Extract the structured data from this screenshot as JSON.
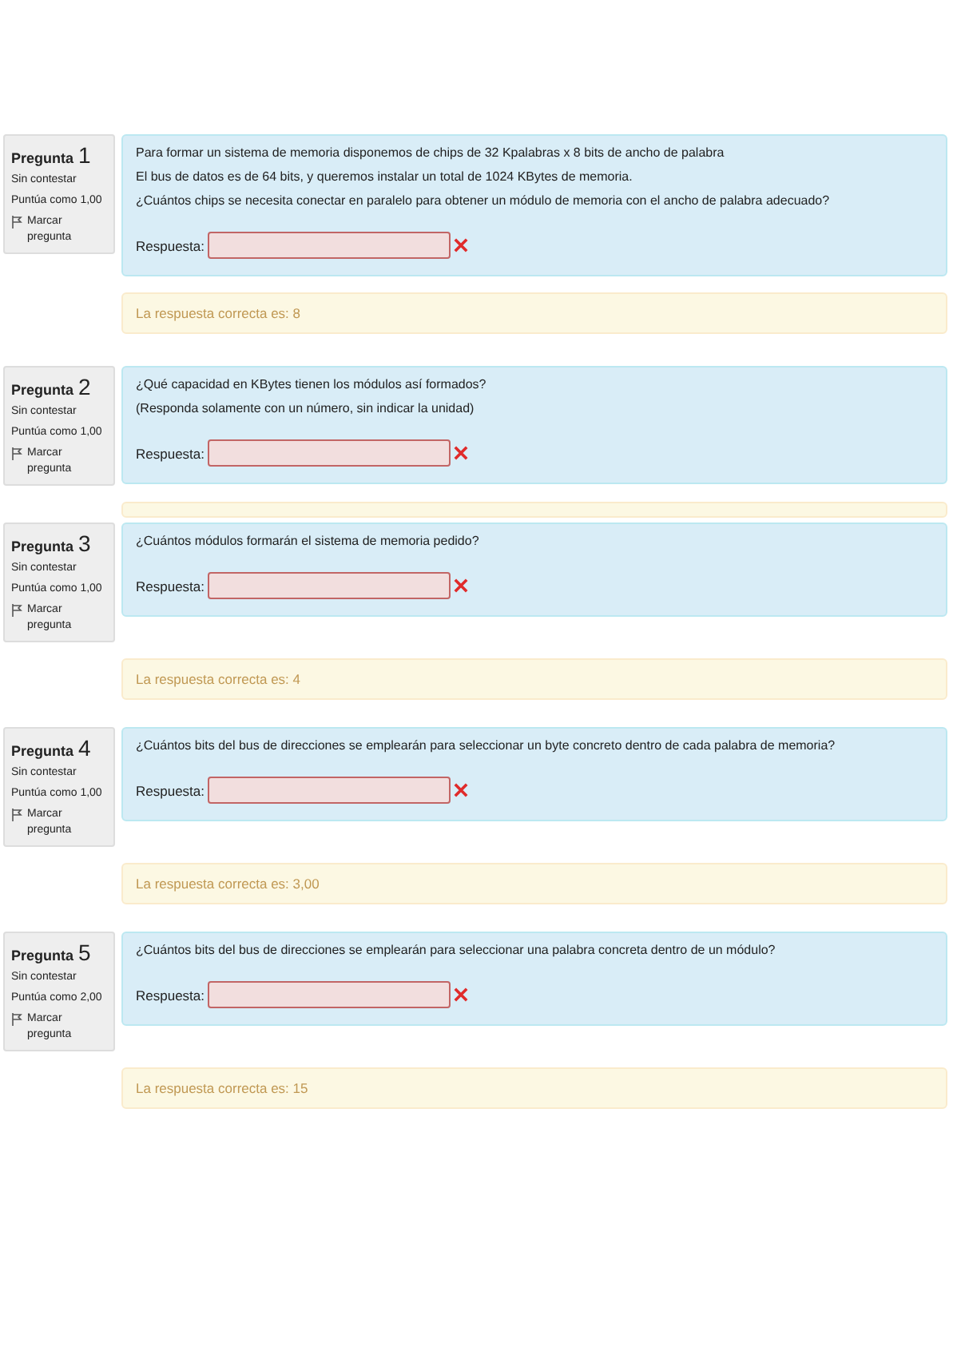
{
  "questions": [
    {
      "label": "Pregunta",
      "number": "1",
      "status": "Sin contestar",
      "points": "Puntúa como 1,00",
      "flag": "Marcar pregunta",
      "text": [
        "Para formar un sistema de memoria disponemos de chips de 32 Kpalabras x 8 bits de ancho de palabra",
        "El bus de datos es de 64 bits, y queremos instalar un total de 1024 KBytes de memoria.",
        "¿Cuántos chips se necesita conectar en paralelo para obtener un módulo de memoria con el ancho de palabra adecuado?"
      ],
      "answer_label": "Respuesta:",
      "incorrect": true,
      "feedback": "La respuesta correcta es: 8"
    },
    {
      "label": "Pregunta",
      "number": "2",
      "status": "Sin contestar",
      "points": "Puntúa como 1,00",
      "flag": "Marcar pregunta",
      "text": [
        "¿Qué capacidad en KBytes tienen los módulos así formados?",
        "(Responda solamente con un número, sin indicar la unidad)"
      ],
      "answer_label": "Respuesta:",
      "incorrect": true,
      "feedback_hidden": true
    },
    {
      "label": "Pregunta",
      "number": "3",
      "status": "Sin contestar",
      "points": "Puntúa como 1,00",
      "flag": "Marcar pregunta",
      "text": [
        "¿Cuántos módulos formarán el sistema de memoria pedido?"
      ],
      "answer_label": "Respuesta:",
      "incorrect": true,
      "feedback": "La respuesta correcta es: 4"
    },
    {
      "label": "Pregunta",
      "number": "4",
      "status": "Sin contestar",
      "points": "Puntúa como 1,00",
      "flag": "Marcar pregunta",
      "text": [
        "¿Cuántos bits del bus de direcciones se emplearán para seleccionar un byte concreto dentro de cada palabra de memoria?"
      ],
      "answer_label": "Respuesta:",
      "incorrect": true,
      "feedback": "La respuesta correcta es: 3,00"
    },
    {
      "label": "Pregunta",
      "number": "5",
      "status": "Sin contestar",
      "points": "Puntúa como 2,00",
      "flag": "Marcar pregunta",
      "text": [
        "¿Cuántos bits del bus de direcciones se emplearán para seleccionar una palabra concreta dentro de un módulo?"
      ],
      "answer_label": "Respuesta:",
      "incorrect": true,
      "feedback": "La respuesta correcta es: 15"
    }
  ]
}
